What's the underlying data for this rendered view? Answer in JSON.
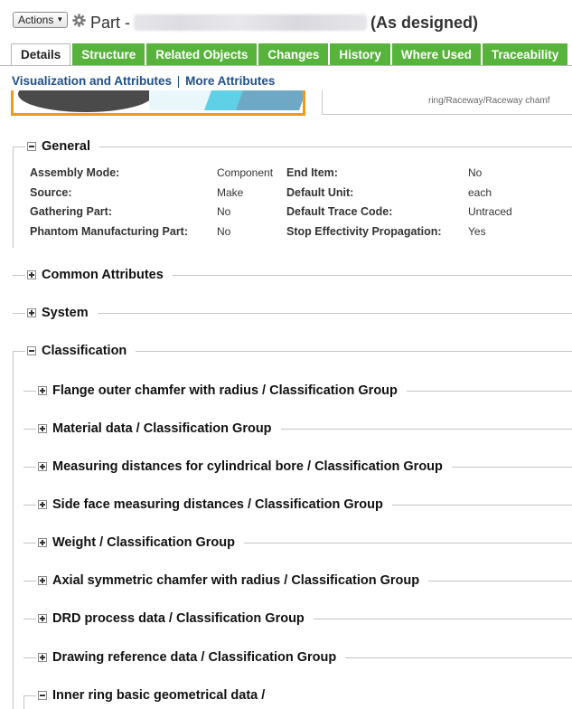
{
  "header": {
    "actions_label": "Actions",
    "part_prefix": "Part -",
    "status_label": "(As designed)",
    "gear_icon": "gear-icon"
  },
  "tabs": [
    {
      "label": "Details",
      "active": true
    },
    {
      "label": "Structure"
    },
    {
      "label": "Related Objects"
    },
    {
      "label": "Changes"
    },
    {
      "label": "History"
    },
    {
      "label": "Where Used"
    },
    {
      "label": "Traceability"
    }
  ],
  "subnav": {
    "visualization": "Visualization and Attributes",
    "separator": "|",
    "more": "More Attributes"
  },
  "info_box_text": "ring/Raceway/Raceway chamf",
  "general": {
    "title": "General",
    "left": [
      {
        "label": "Assembly Mode:",
        "value": "Component"
      },
      {
        "label": "Source:",
        "value": "Make"
      },
      {
        "label": "Gathering Part:",
        "value": "No"
      },
      {
        "label": "Phantom Manufacturing Part:",
        "value": "No"
      }
    ],
    "right": [
      {
        "label": "End Item:",
        "value": "No"
      },
      {
        "label": "Default Unit:",
        "value": "each"
      },
      {
        "label": "Default Trace Code:",
        "value": "Untraced"
      },
      {
        "label": "Stop Effectivity Propagation:",
        "value": "Yes"
      }
    ]
  },
  "sections": {
    "common": "Common Attributes",
    "system": "System",
    "classification": "Classification"
  },
  "classification_groups": [
    "Flange outer chamfer with radius / Classification Group",
    "Material data / Classification Group",
    "Measuring distances for cylindrical bore / Classification Group",
    "Side face measuring distances / Classification Group",
    "Weight / Classification Group",
    "Axial symmetric chamfer with radius / Classification Group",
    "DRD process data / Classification Group",
    "Drawing reference data / Classification Group",
    "Inner ring basic geometrical data /"
  ],
  "colors": {
    "tab_green": "#58b33c",
    "link_blue": "#1f4f8a",
    "thumbnail_border": "#ef9a1a"
  }
}
